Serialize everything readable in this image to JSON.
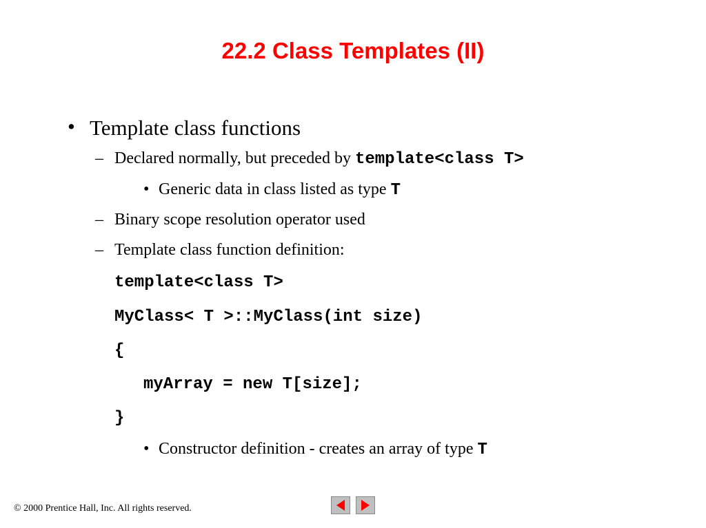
{
  "title": "22.2  Class Templates (II)",
  "content": {
    "main_bullet": "Template class functions",
    "sub1": {
      "text": "Declared normally, but preceded by ",
      "code": "template<class T>"
    },
    "sub1_child": {
      "text": "Generic data in class listed as type ",
      "code": "T"
    },
    "sub2": "Binary scope resolution operator used",
    "sub3": "Template class function definition:",
    "code_lines": {
      "line1": "template<class T>",
      "line2": "MyClass< T >::MyClass(int size)",
      "line3": "{",
      "line4": "myArray = new T[size];",
      "line5": "}"
    },
    "sub_last": {
      "text": "Constructor definition - creates an array of type ",
      "code": "T"
    }
  },
  "footer": {
    "copyright": "© 2000 Prentice Hall, Inc.  All rights reserved."
  }
}
